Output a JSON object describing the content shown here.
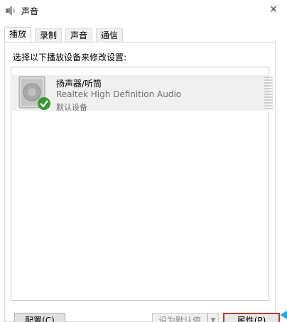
{
  "window": {
    "title": "声音",
    "close_glyph": "×"
  },
  "tabs": [
    {
      "label": "播放",
      "active": true
    },
    {
      "label": "录制",
      "active": false
    },
    {
      "label": "声音",
      "active": false
    },
    {
      "label": "通信",
      "active": false
    }
  ],
  "panel": {
    "instruction": "选择以下播放设备来修改设置:"
  },
  "devices": [
    {
      "name": "扬声器/听筒",
      "driver": "Realtek High Definition Audio",
      "status": "默认设备",
      "icon": "speaker-icon",
      "default_badge": "check-icon"
    }
  ],
  "buttons": {
    "configure": "配置(C)",
    "set_default": "设为默认值(S)",
    "set_default_arrow": "▼",
    "properties": "属性(P)"
  },
  "colors": {
    "selected_row": "#f0f0f0",
    "check_green": "#3a9a32",
    "highlight_border": "#c0392b"
  }
}
